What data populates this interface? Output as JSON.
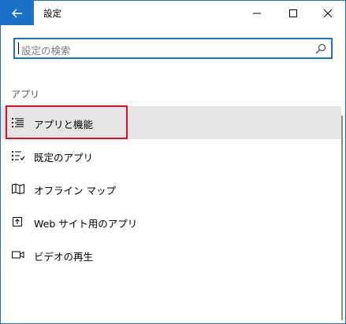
{
  "window": {
    "title": "設定",
    "controls": {
      "minimize": "minimize-icon",
      "maximize": "maximize-icon",
      "close": "close-icon"
    },
    "accent_color": "#1a73c7"
  },
  "search": {
    "placeholder": "設定の検索",
    "value": ""
  },
  "section": {
    "title": "アプリ"
  },
  "nav": {
    "items": [
      {
        "label": "アプリと機能",
        "icon": "apps-list-icon",
        "selected": true
      },
      {
        "label": "既定のアプリ",
        "icon": "default-apps-icon",
        "selected": false
      },
      {
        "label": "オフライン マップ",
        "icon": "map-icon",
        "selected": false
      },
      {
        "label": "Web サイト用のアプリ",
        "icon": "open-in-app-icon",
        "selected": false
      },
      {
        "label": "ビデオの再生",
        "icon": "video-icon",
        "selected": false
      }
    ]
  },
  "annotation": {
    "highlight_color": "#e0141e"
  }
}
